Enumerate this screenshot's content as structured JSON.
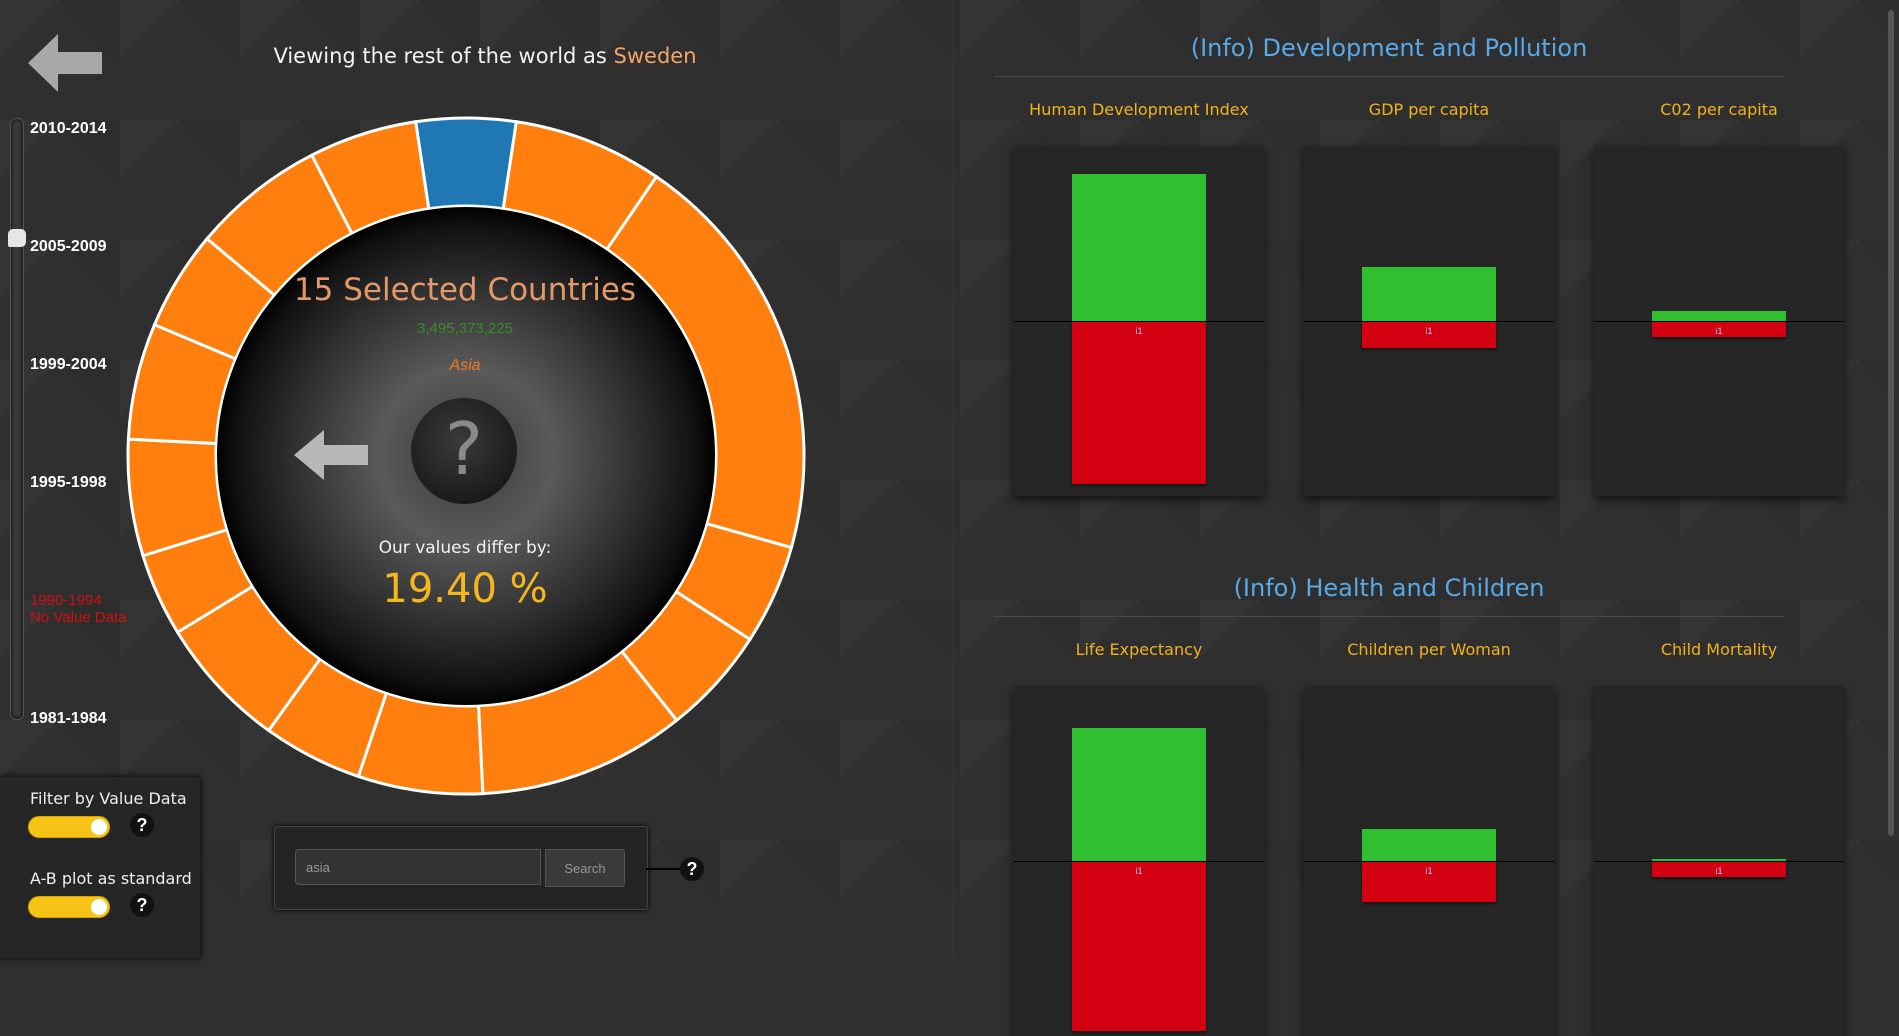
{
  "header": {
    "title_prefix": "Viewing the rest of the world as ",
    "country": "Sweden"
  },
  "timeline": {
    "periods": [
      {
        "label": "2010-2014",
        "has_data": true
      },
      {
        "label": "2005-2009",
        "has_data": true,
        "selected": true
      },
      {
        "label": "1999-2004",
        "has_data": true
      },
      {
        "label": "1995-1998",
        "has_data": true
      },
      {
        "label": "1990-1994",
        "sub": "No Value Data",
        "has_data": false
      },
      {
        "label": "1981-1984",
        "has_data": true
      }
    ]
  },
  "donut": {
    "selected_color": "#1f77b4",
    "default_color": "#ff7f0e",
    "segments": [
      12,
      18,
      50,
      12,
      13,
      25,
      15,
      12,
      16,
      10,
      14,
      14,
      12,
      16,
      13
    ]
  },
  "center": {
    "selected_count": "15 Selected Countries",
    "population": "3,495,373,225",
    "region": "Asia",
    "differ_label": "Our values differ by:",
    "differ_value": "19.40 %",
    "question": "?"
  },
  "filters": {
    "filter_value_label": "Filter by Value Data",
    "ab_plot_label": "A-B plot as standard",
    "help": "?",
    "filter_value_on": true,
    "ab_plot_on": true
  },
  "search": {
    "value": "asia",
    "button_label": "Search",
    "help": "?"
  },
  "sections": [
    {
      "title": "(Info) Development and Pollution",
      "metrics": [
        {
          "name": "Human Development Index",
          "green": 0.92,
          "red": 0.88,
          "label": "i1"
        },
        {
          "name": "GDP per capita",
          "green": 0.34,
          "red": 0.14,
          "label": "i1"
        },
        {
          "name": "C02 per capita",
          "green": 0.06,
          "red": 0.08,
          "label": "i1"
        }
      ]
    },
    {
      "title": "(Info) Health and Children",
      "metrics": [
        {
          "name": "Life Expectancy",
          "green": 0.83,
          "red": 0.92,
          "label": "i1"
        },
        {
          "name": "Children per Woman",
          "green": 0.2,
          "red": 0.22,
          "label": "i1"
        },
        {
          "name": "Child Mortality",
          "green": 0.01,
          "red": 0.08,
          "label": "i1"
        }
      ]
    }
  ]
}
